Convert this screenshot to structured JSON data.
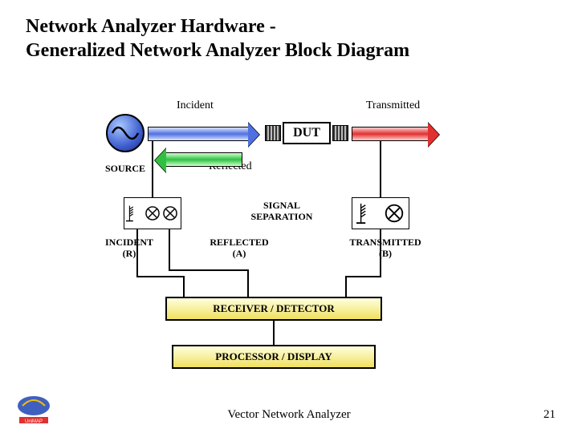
{
  "title_line1": "Network Analyzer Hardware -",
  "title_line2": "Generalized Network Analyzer Block Diagram",
  "labels": {
    "incident": "Incident",
    "transmitted": "Transmitted",
    "reflected": "Reflected",
    "dut": "DUT",
    "source": "SOURCE",
    "signal_sep_1": "SIGNAL",
    "signal_sep_2": "SEPARATION",
    "inc_r_1": "INCIDENT",
    "inc_r_2": "(R)",
    "refl_a_1": "REFLECTED",
    "refl_a_2": "(A)",
    "trans_b_1": "TRANSMITTED",
    "trans_b_2": "(B)",
    "receiver": "RECEIVER / DETECTOR",
    "processor": "PROCESSOR / DISPLAY"
  },
  "footer": "Vector Network Analyzer",
  "page": "21"
}
